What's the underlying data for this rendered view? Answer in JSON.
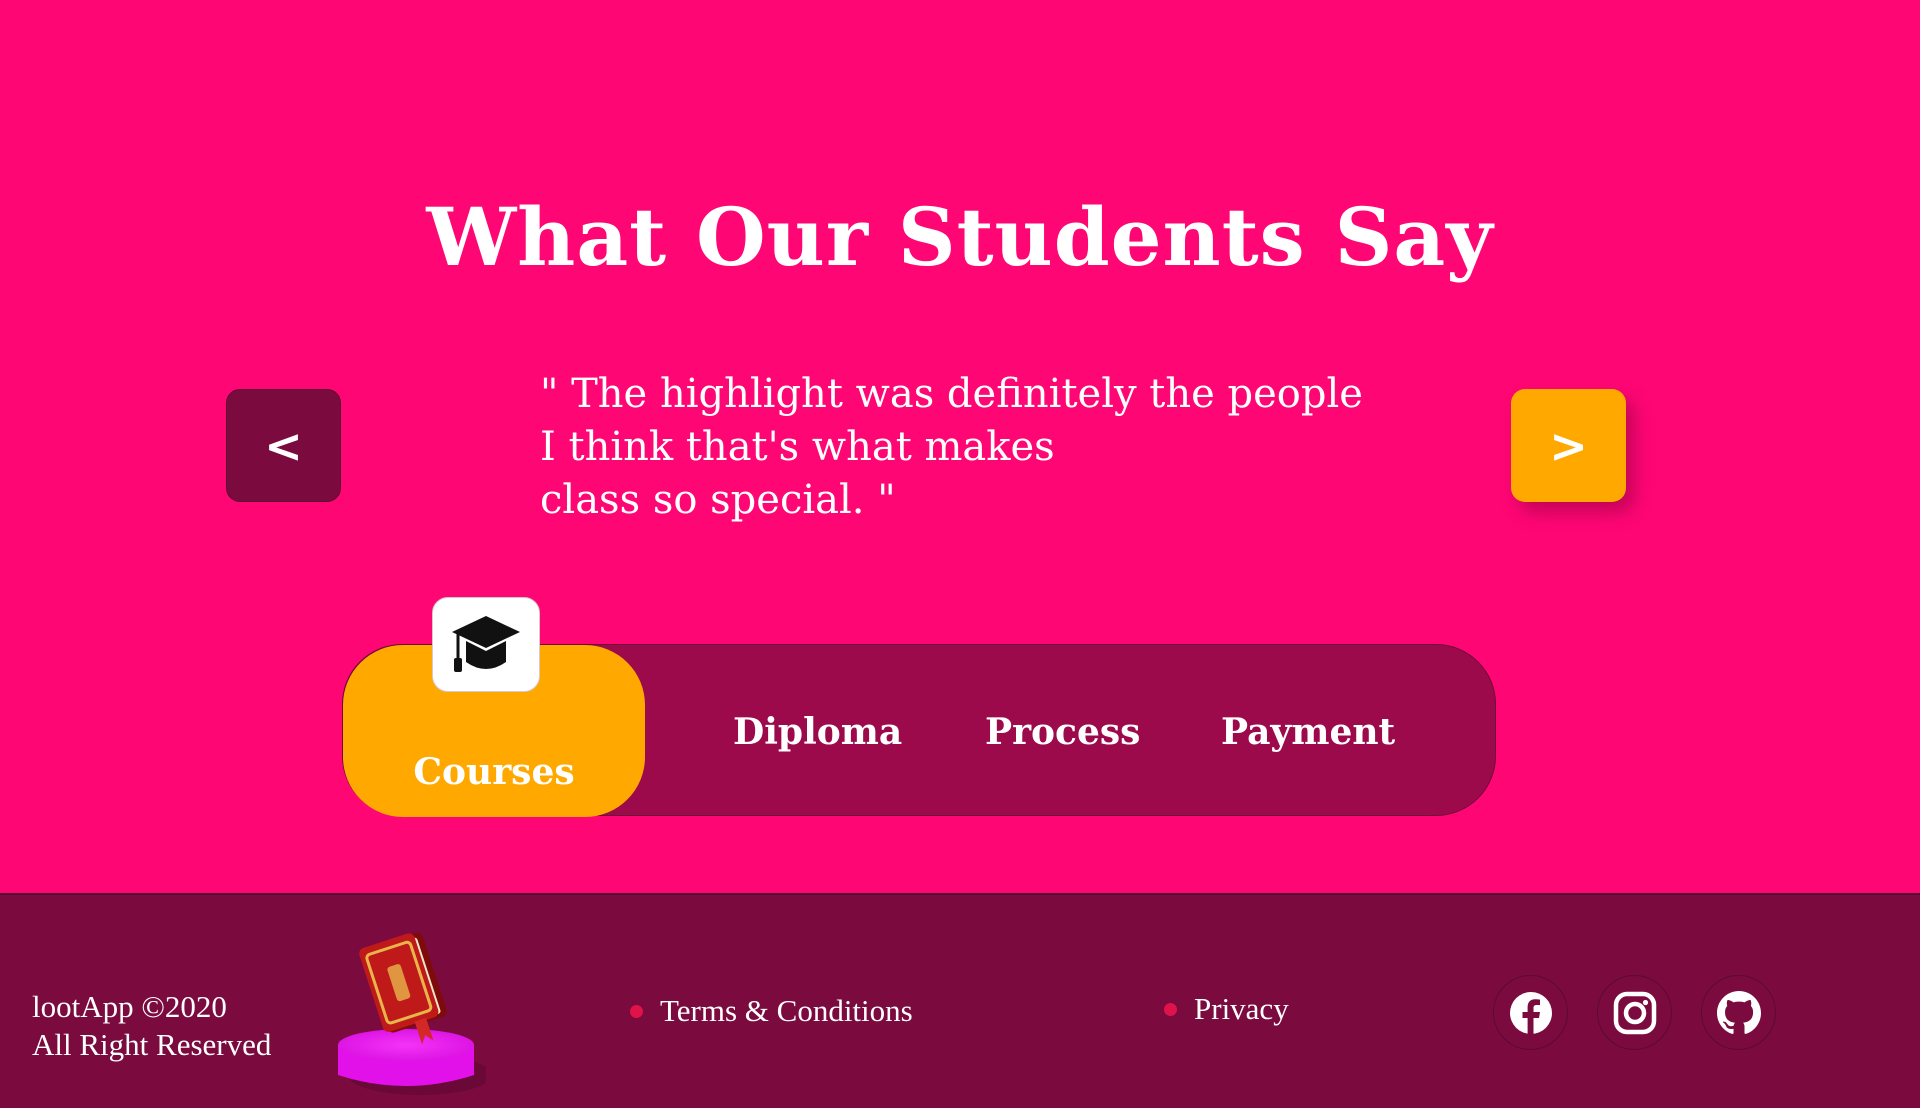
{
  "testimonials": {
    "title": "What Our Students Say",
    "prev_label": "<",
    "next_label": ">",
    "quote": "\" The highlight was definitely the people\nI think that's what makes\nclass so special. \""
  },
  "tabs": [
    {
      "label": "Courses",
      "active": true,
      "icon": "graduation-cap-icon"
    },
    {
      "label": "Diploma",
      "active": false
    },
    {
      "label": "Process",
      "active": false
    },
    {
      "label": "Payment",
      "active": false
    }
  ],
  "footer": {
    "copyright_line1": "lootApp ©2020",
    "copyright_line2": "All Right Reserved",
    "links": [
      {
        "label": "Terms & Conditions"
      },
      {
        "label": "Privacy"
      }
    ],
    "social": [
      "facebook-icon",
      "instagram-icon",
      "github-icon"
    ]
  },
  "colors": {
    "background": "#ff0675",
    "accent": "#ffa800",
    "dark": "#7b0a3f",
    "tab_bar": "#9c0a4b",
    "link_dot": "#e0124a"
  }
}
